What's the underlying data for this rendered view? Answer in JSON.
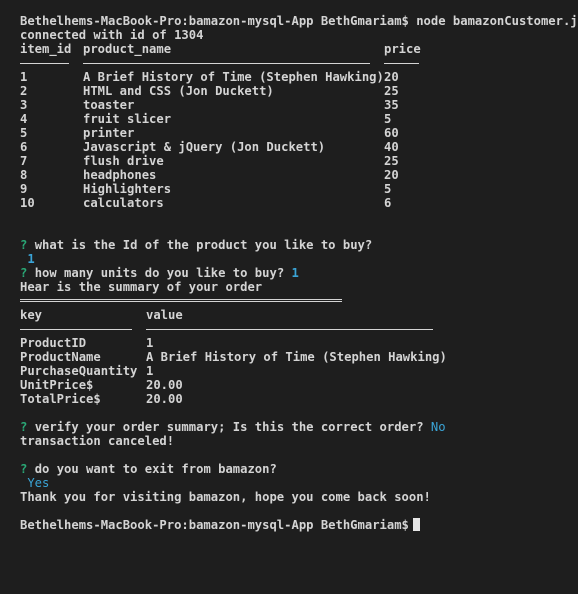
{
  "prompt_line_1": "Bethelhems-MacBook-Pro:bamazon-mysql-App BethGmariam$ node bamazonCustomer.js",
  "connected": "connected with id of 1304",
  "table": {
    "headers": [
      "item_id",
      "product_name",
      "price"
    ],
    "rows": [
      [
        "1",
        "A Brief History of Time (Stephen Hawking)",
        "20"
      ],
      [
        "2",
        "HTML and CSS (Jon Duckett)",
        "25"
      ],
      [
        "3",
        "toaster",
        "35"
      ],
      [
        "4",
        "fruit slicer",
        "5"
      ],
      [
        "5",
        "printer",
        "60"
      ],
      [
        "6",
        "Javascript & jQuery (Jon Duckett)",
        "40"
      ],
      [
        "7",
        "flush drive",
        "25"
      ],
      [
        "8",
        "headphones",
        "20"
      ],
      [
        "9",
        "Highlighters",
        "5"
      ],
      [
        "10",
        "calculators",
        "6"
      ]
    ]
  },
  "q1": {
    "mark": "?",
    "text": "what is the Id of the product you like to buy?",
    "answer": "1"
  },
  "q2": {
    "mark": "?",
    "text": "how many units do you like to buy?",
    "answer": "1"
  },
  "summary_title": "Hear is the summary of your order",
  "summary": {
    "headers": [
      "key",
      "value"
    ],
    "rows": [
      [
        "ProductID",
        "1"
      ],
      [
        "ProductName",
        "A Brief History of Time (Stephen Hawking)"
      ],
      [
        "PurchaseQuantity",
        "1"
      ],
      [
        "UnitPrice$",
        "20.00"
      ],
      [
        "TotalPrice$",
        "20.00"
      ]
    ]
  },
  "q3": {
    "mark": "?",
    "text": "verify your order summary; Is this the correct order?",
    "answer": "No"
  },
  "canceled": "transaction canceled!",
  "q4": {
    "mark": "?",
    "text": "do you want to exit from bamazon?",
    "answer": "Yes"
  },
  "goodbye": "Thank you for visiting bamazon, hope you come back soon!",
  "prompt_line_2": "Bethelhems-MacBook-Pro:bamazon-mysql-App BethGmariam$",
  "colors": {
    "background": "#1e1e1e",
    "text": "#d4d4d4",
    "question_mark": "#2aa876",
    "answer": "#3aa4d6"
  }
}
